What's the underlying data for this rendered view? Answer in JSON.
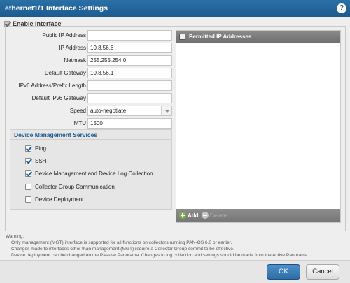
{
  "window": {
    "title": "ethernet1/1 Interface Settings",
    "help_icon": "question-icon"
  },
  "enable": {
    "label": "Enable Interface",
    "checked": true
  },
  "fields": [
    {
      "label": "Public IP Address",
      "value": ""
    },
    {
      "label": "IP Address",
      "value": "10.8.56.6"
    },
    {
      "label": "Netmask",
      "value": "255.255.254.0"
    },
    {
      "label": "Default Gateway",
      "value": "10.8.56.1"
    },
    {
      "label": "IPv6 Address/Prefix Length",
      "value": ""
    },
    {
      "label": "Default IPv6 Gateway",
      "value": ""
    }
  ],
  "speed": {
    "label": "Speed",
    "value": "auto-negotiate"
  },
  "mtu": {
    "label": "MTU",
    "value": "1500"
  },
  "services": {
    "title": "Device Management Services",
    "options": [
      {
        "label": "Ping",
        "checked": true
      },
      {
        "label": "SSH",
        "checked": true
      },
      {
        "label": "Device Management and Device Log Collection",
        "checked": true
      },
      {
        "label": "Collector Group Communication",
        "checked": false
      },
      {
        "label": "Device Deployment",
        "checked": false
      }
    ]
  },
  "permitted": {
    "header": "Permitted IP Addresses",
    "add_label": "Add",
    "delete_label": "Delete"
  },
  "warning": {
    "title": "Warning:",
    "lines": [
      "Only management (MGT) interface is supported for all functions on collectors running PAN-OS 6.0 or earlier.",
      "Changes made to interfaces other than management (MGT) require a Collector Group commit to be effective.",
      "Device deployment can be changed on the Passive Panorama. Changes to log collection and settings should be made from the Active Panorama."
    ]
  },
  "buttons": {
    "ok": "OK",
    "cancel": "Cancel"
  },
  "colors": {
    "titlebar": "#1c5a8e",
    "ok_button": "#2e6ea6",
    "checkmark": "#1c5a8e"
  }
}
